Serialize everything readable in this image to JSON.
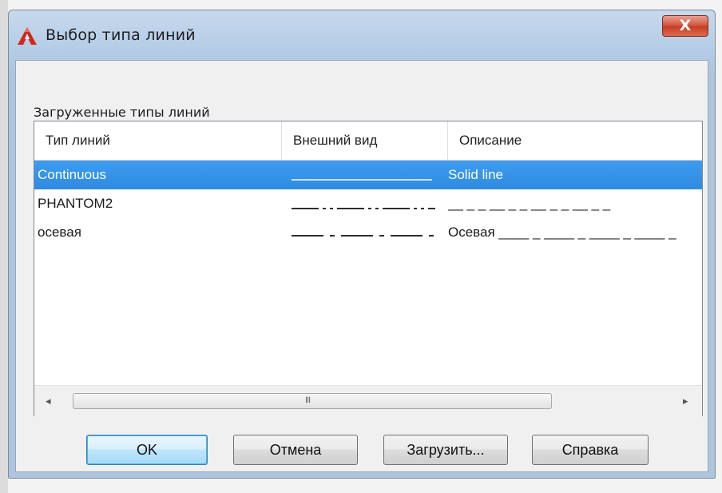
{
  "window": {
    "title": "Выбор типа линий",
    "close_label": "X",
    "app_icon": "autocad-a-icon"
  },
  "group_label": "Загруженные типы линий",
  "columns": [
    "Тип линий",
    "Внешний вид",
    "Описание"
  ],
  "rows": [
    {
      "name": "Continuous",
      "appearance": "solid",
      "description": "Solid line",
      "selected": true
    },
    {
      "name": "PHANTOM2",
      "appearance": "phantom",
      "description": "__ _ _ __ _ _ __ _ _ __ _ _",
      "selected": false
    },
    {
      "name": "осевая",
      "appearance": "center",
      "description": "Осевая ____ _ ____ _ ____ _ ____ _",
      "selected": false
    }
  ],
  "scrollbar": {
    "grip": "III",
    "left_arrow": "◂",
    "right_arrow": "▸"
  },
  "buttons": {
    "ok": "OK",
    "cancel": "Отмена",
    "load": "Загрузить...",
    "help": "Справка"
  },
  "colors": {
    "selection": "#3399ff",
    "close_button": "#c94128",
    "default_button": "#bee6fd"
  }
}
